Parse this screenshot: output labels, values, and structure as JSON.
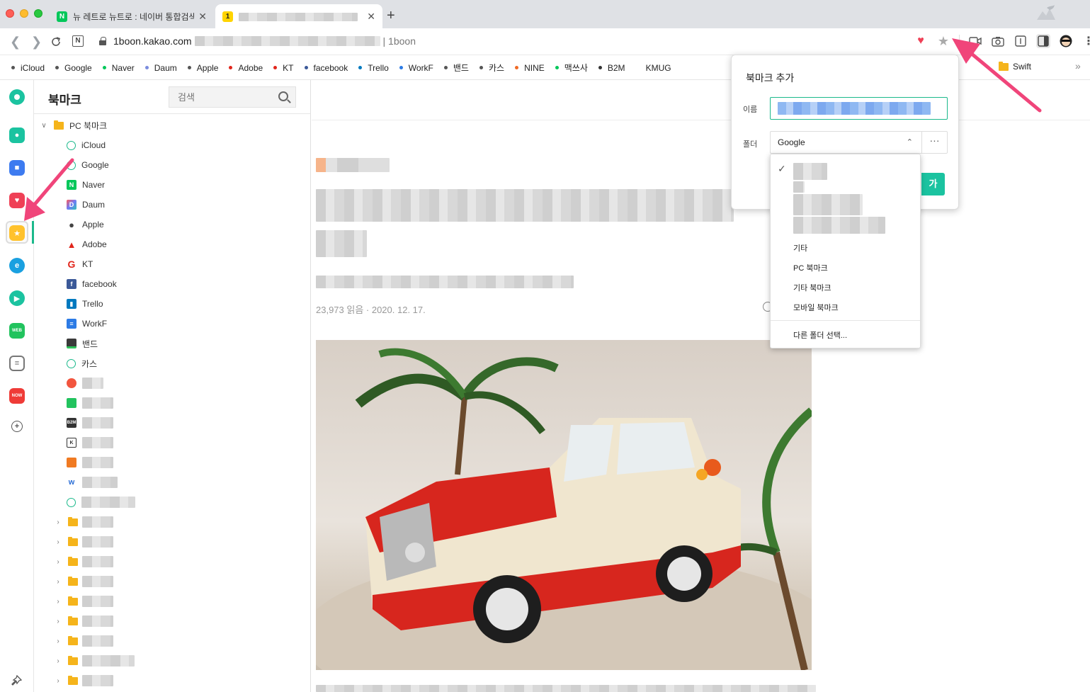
{
  "tabs": [
    {
      "favicon": "N",
      "title": "뉴 레트로 뉴트로 : 네이버 통합검색",
      "close": "✕"
    },
    {
      "favicon": "1",
      "title": "",
      "close": "✕"
    }
  ],
  "new_tab": "+",
  "address": {
    "host": "1boon.kakao.com",
    "suffix": "| 1boon"
  },
  "bookmark_bar": {
    "items": [
      {
        "label": "iCloud",
        "color": "#555555"
      },
      {
        "label": "Google",
        "color": "#555555"
      },
      {
        "label": "Naver",
        "color": "#03c75a"
      },
      {
        "label": "Daum",
        "color": "#7b8cde"
      },
      {
        "label": "Apple",
        "color": "#555555"
      },
      {
        "label": "Adobe",
        "color": "#e1251b"
      },
      {
        "label": "KT",
        "color": "#e1251b"
      },
      {
        "label": "facebook",
        "color": "#3b5998"
      },
      {
        "label": "Trello",
        "color": "#0079bf"
      },
      {
        "label": "WorkF",
        "color": "#2c7be5"
      },
      {
        "label": "밴드",
        "color": "#555555"
      },
      {
        "label": "카스",
        "color": "#555555"
      },
      {
        "label": "NINE",
        "color": "#f06a24"
      },
      {
        "label": "맥쓰사",
        "color": "#03c75a"
      },
      {
        "label": "B2M",
        "color": "#333333"
      },
      {
        "label": "KMUG",
        "color": ""
      }
    ],
    "folder_right": "Swift",
    "overflow": "»"
  },
  "panel": {
    "title": "북마크",
    "search_placeholder": "검색",
    "root": "PC 북마크",
    "items": [
      {
        "label": "iCloud",
        "icon": "circle-icon"
      },
      {
        "label": "Google",
        "icon": "circle-icon"
      },
      {
        "label": "Naver",
        "icon": "naver-icon"
      },
      {
        "label": "Daum",
        "icon": "daum-icon"
      },
      {
        "label": "Apple",
        "icon": "apple-icon"
      },
      {
        "label": "Adobe",
        "icon": "adobe-icon"
      },
      {
        "label": "KT",
        "icon": "kt-icon"
      },
      {
        "label": "facebook",
        "icon": "facebook-icon"
      },
      {
        "label": "Trello",
        "icon": "trello-icon"
      },
      {
        "label": "WorkF",
        "icon": "workf-icon"
      },
      {
        "label": "밴드",
        "icon": "band-icon"
      },
      {
        "label": "카스",
        "icon": "circle-icon"
      }
    ]
  },
  "article": {
    "meta": "23,973 읽음 · 2020. 12. 17."
  },
  "popup": {
    "title": "북마크 추가",
    "name_label": "이름",
    "folder_label": "폴더",
    "folder_value": "Google",
    "more": "···",
    "add_button": "가"
  },
  "dropdown": {
    "items": [
      "기타",
      "PC 북마크",
      "기타 북마크",
      "모바일 북마크"
    ],
    "other_folder": "다른 폴더 선택..."
  },
  "colors": {
    "accent": "#1bb98b",
    "arrow": "#f0457a",
    "add_button": "#1bc3a0"
  }
}
